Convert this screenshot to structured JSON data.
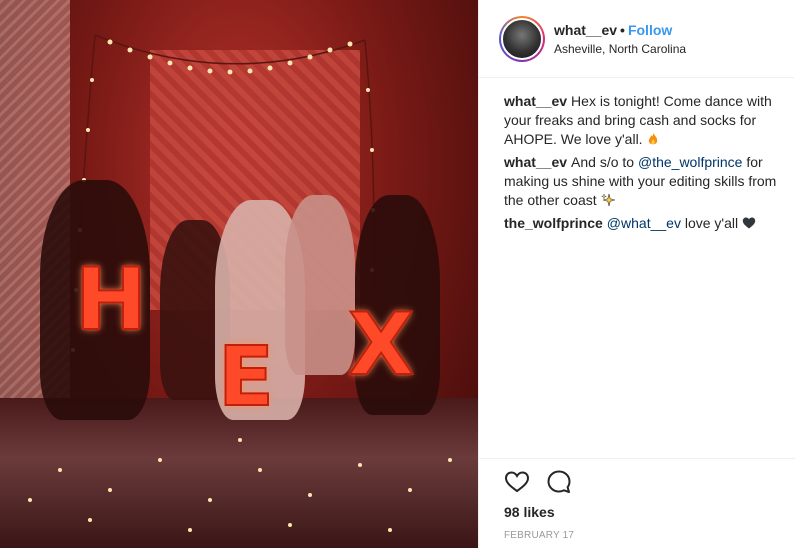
{
  "post": {
    "author": {
      "username": "what__ev",
      "separator": "•",
      "follow_label": "Follow",
      "location": "Asheville, North Carolina"
    },
    "photo": {
      "balloon_letters": [
        "H",
        "E",
        "X"
      ]
    },
    "comments": [
      {
        "username": "what__ev",
        "text": "Hex is tonight! Come dance with your freaks and bring cash and socks for AHOPE. We love y'all.",
        "emoji": "fire-icon"
      },
      {
        "username": "what__ev",
        "text_before": "And s/o to",
        "mention": "@the_wolfprince",
        "text_after": "for making us shine with your editing skills from the other coast",
        "emoji": "sparkles-icon"
      },
      {
        "username": "the_wolfprince",
        "mention": "@what__ev",
        "text_after": "love y'all",
        "emoji": "black-heart-icon"
      }
    ],
    "actions": {
      "like_icon": "heart-outline-icon",
      "comment_icon": "comment-bubble-icon"
    },
    "likes": "98 likes",
    "date": "FEBRUARY 17",
    "colors": {
      "link": "#3897f0",
      "mention": "#003569",
      "text": "#262626",
      "muted": "#999999",
      "border": "#efefef"
    }
  }
}
